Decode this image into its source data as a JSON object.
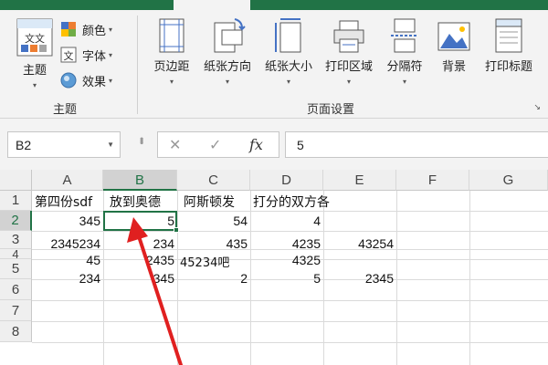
{
  "ribbon": {
    "theme_group": {
      "theme_button": "主题",
      "colors_button": "颜色",
      "fonts_button": "字体",
      "effects_button": "效果",
      "group_label": "主题",
      "theme_icon_text": "文文"
    },
    "page_setup_group": {
      "buttons": [
        "页边距",
        "纸张方向",
        "纸张大小",
        "打印区域",
        "分隔符",
        "背景",
        "打印标题"
      ],
      "group_label": "页面设置"
    }
  },
  "formula_bar": {
    "name_box": "B2",
    "cancel_glyph": "✕",
    "enter_glyph": "✓",
    "fx_label": "fx",
    "formula_value": "5"
  },
  "sheet": {
    "columns": [
      "A",
      "B",
      "C",
      "D",
      "E",
      "F",
      "G"
    ],
    "rows": [
      "1",
      "2",
      "3",
      "4",
      "5",
      "6",
      "7",
      "8"
    ],
    "cells": {
      "A1": "第四份sdf",
      "B1": "放到奥德",
      "C1": "阿斯顿发",
      "D1": "打分的双方各",
      "A2": "345",
      "B2": "5",
      "C2": "54",
      "D2": "4",
      "A3": "2345234",
      "B3": "234",
      "C3": "435",
      "D3": "4235",
      "E3": "43254",
      "A4": "45",
      "B4": "2435",
      "C4": "45234吧",
      "D4": "4325",
      "A5": "234",
      "B5": "345",
      "C5": "2",
      "D5": "5",
      "E5": "2345"
    },
    "selected_cell": "B2",
    "accent_color": "#217346",
    "annotation_color": "#e02020"
  }
}
